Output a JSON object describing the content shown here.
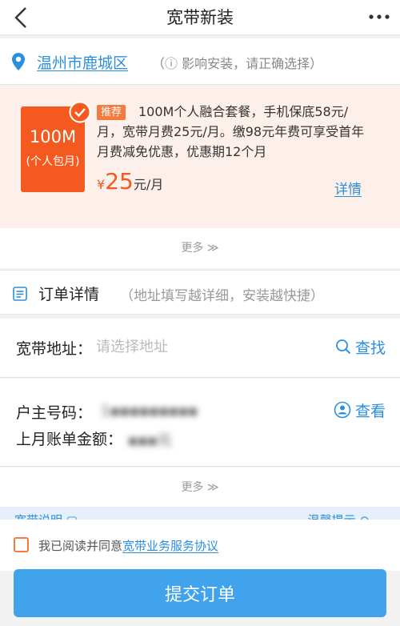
{
  "header": {
    "title": "宽带新装"
  },
  "location": {
    "city": "温州市鹿城区",
    "hint": "（ⓘ 影响安装，请正确选择）"
  },
  "package": {
    "badge_main": "100M",
    "badge_sub": "(个人包月)",
    "tag": "推荐",
    "description": "100M个人融合套餐，手机保底58元/月，宽带月费25元/月。缴98元年费可享受首年月费减免优惠，优惠期12个月",
    "price_currency": "¥",
    "price_value": "25",
    "price_unit": "元/月",
    "detail_link": "详情"
  },
  "more_label": "更多 ≫",
  "order": {
    "title": "订单详情",
    "hint": "（地址填写越详细，安装越快捷）",
    "address_label": "宽带地址：",
    "address_placeholder": "请选择地址",
    "address_value": "",
    "search_label": "查找",
    "owner_label": "户主号码：",
    "owner_value": "1▪▪▪▪▪▪▪▪▪",
    "view_label": "查看",
    "bill_label": "上月账单金额：",
    "bill_value": "▪▪▪元"
  },
  "notes": {
    "left": "宽带说明 ▢",
    "right": "温馨提示 ⊙"
  },
  "agreement": {
    "text": "我已阅读并同意",
    "link": "宽带业务服务协议"
  },
  "submit_label": "提交订单",
  "colors": {
    "accent": "#2b8fe0",
    "orange": "#f45a1f",
    "button": "#41a3ec"
  }
}
